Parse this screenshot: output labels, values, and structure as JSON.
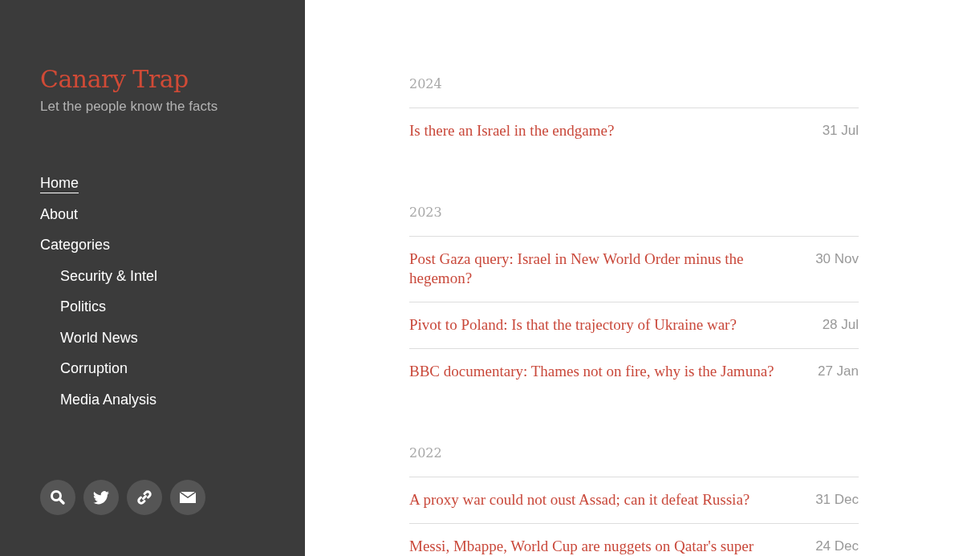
{
  "site": {
    "title": "Canary Trap",
    "tagline": "Let the people know the facts"
  },
  "nav": [
    {
      "label": "Home",
      "selected": true
    },
    {
      "label": "About",
      "selected": false
    },
    {
      "label": "Categories",
      "selected": false,
      "children": [
        {
          "label": "Security & Intel",
          "selected": false
        },
        {
          "label": "Politics",
          "selected": false
        },
        {
          "label": "World News",
          "selected": false
        },
        {
          "label": "Corruption",
          "selected": false
        },
        {
          "label": "Media Analysis",
          "selected": false
        }
      ]
    }
  ],
  "social_buttons": [
    {
      "kind": "search"
    },
    {
      "kind": "twitter"
    },
    {
      "kind": "link"
    },
    {
      "kind": "email"
    }
  ],
  "archive": [
    {
      "year": "2024",
      "posts": [
        {
          "title": "Is there an Israel in the endgame?",
          "date": "31 Jul"
        }
      ]
    },
    {
      "year": "2023",
      "posts": [
        {
          "title": "Post Gaza query: Israel in New World Order minus the hegemon?",
          "date": "30 Nov"
        },
        {
          "title": "Pivot to Poland: Is that the trajectory of Ukraine war?",
          "date": "28 Jul"
        },
        {
          "title": "BBC documentary: Thames not on fire, why is the Jamuna?",
          "date": "27 Jan"
        }
      ]
    },
    {
      "year": "2022",
      "posts": [
        {
          "title": "A proxy war could not oust Assad; can it defeat Russia?",
          "date": "31 Dec"
        },
        {
          "title": "Messi, Mbappe, World Cup are nuggets on Qatar's super",
          "date": "24 Dec"
        }
      ]
    }
  ]
}
